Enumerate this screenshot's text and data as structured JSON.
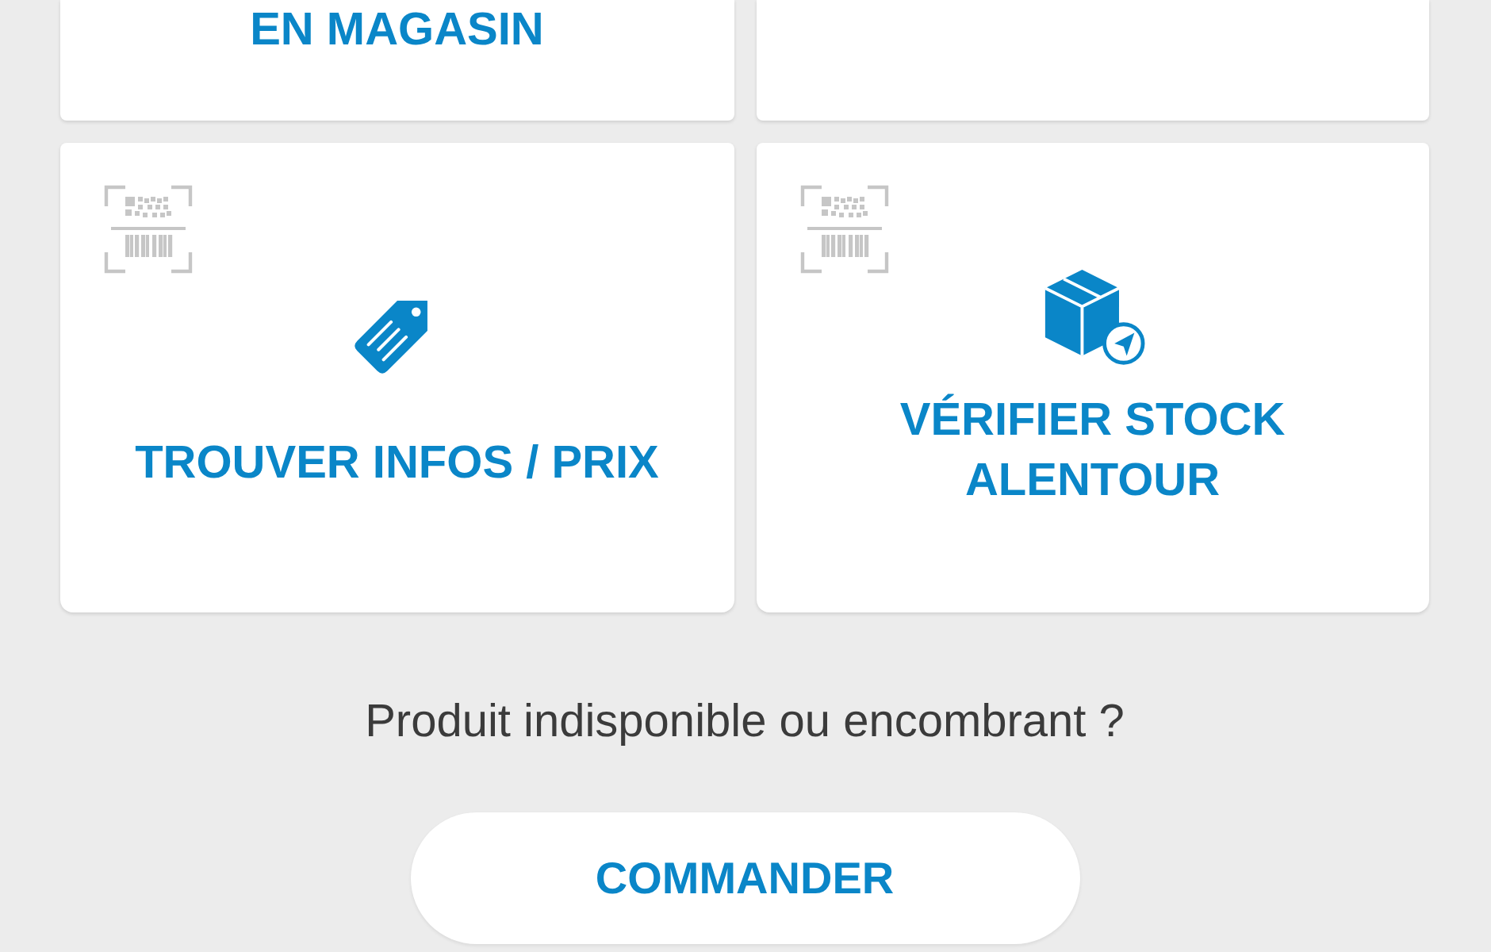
{
  "tiles": [
    {
      "kind": "partial",
      "label": "EN MAGASIN"
    },
    {
      "kind": "partial"
    },
    {
      "kind": "price",
      "label": "TROUVER INFOS / PRIX"
    },
    {
      "kind": "stock",
      "label": "VÉRIFIER STOCK ALENTOUR"
    }
  ],
  "prompt": "Produit indisponible ou encombrant ?",
  "order_button": {
    "label": "COMMANDER"
  }
}
